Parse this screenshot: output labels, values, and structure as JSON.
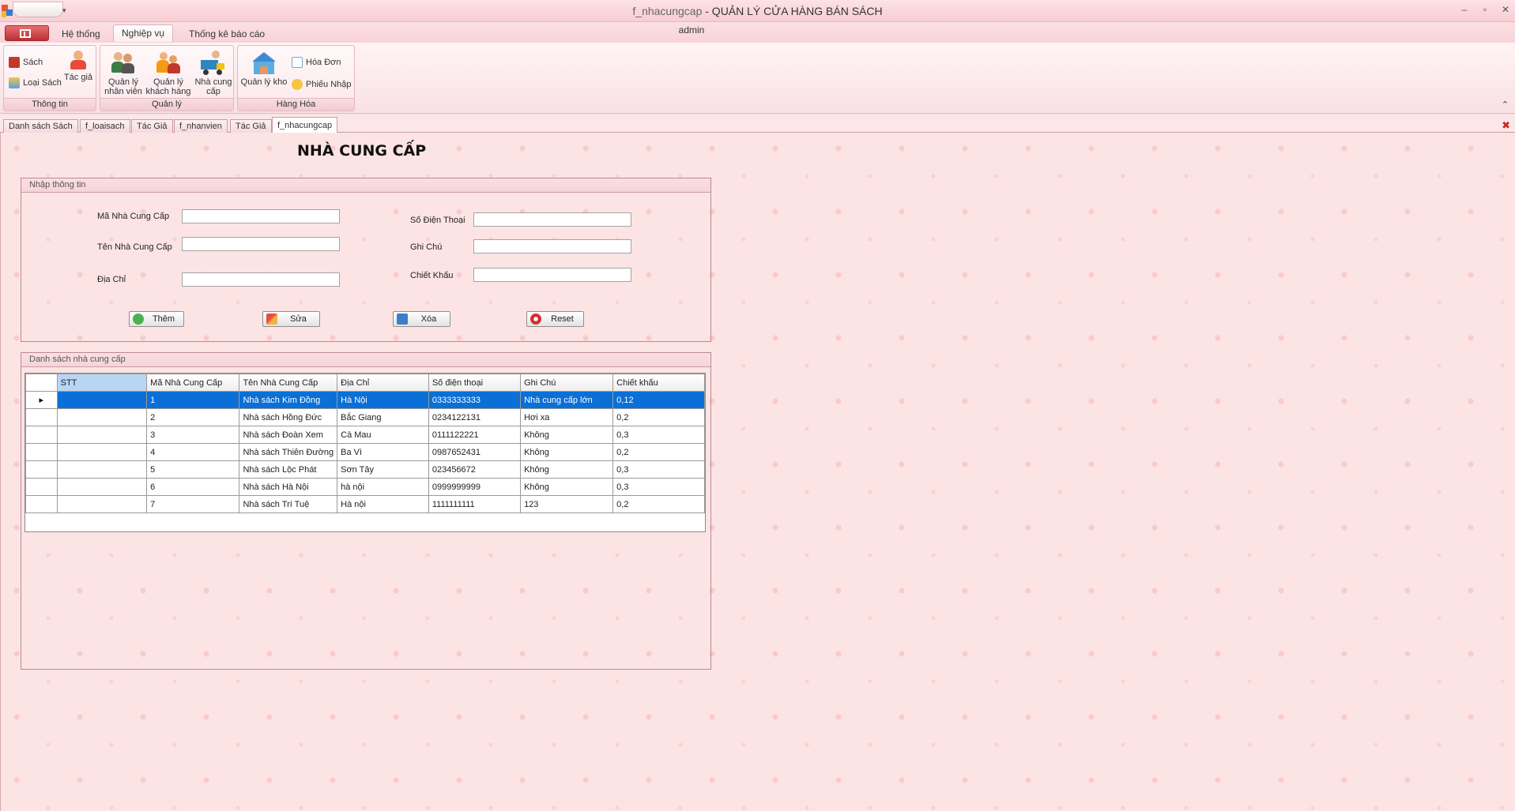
{
  "window": {
    "doc_title": "f_nhacungcap",
    "app_title": " - QUẢN LÝ CỬA HÀNG BÁN SÁCH",
    "controls": [
      "–",
      "▫",
      "✕"
    ]
  },
  "ribbon": {
    "user": "admin",
    "tabs": [
      "Hệ thống",
      "Nghiệp vụ",
      "Thống kê báo cáo"
    ],
    "active_tab": "Nghiệp vụ",
    "groups": {
      "thong_tin": {
        "label": "Thông tin",
        "sach": "Sách",
        "loai_sach": "Loại Sách",
        "tac_gia": "Tác giả"
      },
      "quan_ly": {
        "label": "Quản lý",
        "nhan_vien_1": "Quản lý",
        "nhan_vien_2": "nhân viên",
        "khach_hang_1": "Quản lý",
        "khach_hang_2": "khách hàng",
        "ncc_1": "Nhà cung",
        "ncc_2": "cấp"
      },
      "hang_hoa": {
        "label": "Hàng Hóa",
        "kho": "Quản lý kho",
        "hoa_don": "Hóa Đơn",
        "phieu_nhap": "Phiếu Nhập"
      }
    }
  },
  "doc_tabs": [
    "Danh sách Sách",
    "f_loaisach",
    "Tác Giả",
    "f_nhanvien",
    "Tác Giả",
    "f_nhacungcap"
  ],
  "form": {
    "title": "NHÀ CUNG CẤP",
    "input_group": "Nhập thông tin",
    "labels": {
      "ma": "Mã Nhà Cung Cấp",
      "ten": "Tên Nhà Cung Cấp",
      "dia_chi": "Địa Chỉ",
      "sdt": "Số Điện Thoại",
      "ghi_chu": "Ghi Chú",
      "chiet_khau": "Chiết Khấu"
    },
    "values": {
      "ma": "",
      "ten": "",
      "dia_chi": "",
      "sdt": "",
      "ghi_chu": "",
      "chiet_khau": ""
    },
    "buttons": {
      "them": "Thêm",
      "sua": "Sửa",
      "xoa": "Xóa",
      "reset": "Reset"
    }
  },
  "list": {
    "caption": "Danh sách nhà cung cấp",
    "columns": [
      "STT",
      "Mã Nhà Cung Cấp",
      "Tên Nhà Cung Cấp",
      "Địa Chỉ",
      "Số điện thoại",
      "Ghi Chú",
      "Chiết khấu"
    ],
    "selected_row": 0,
    "rows": [
      [
        "",
        "1",
        "Nhà sách Kim Đồng",
        "Hà Nội",
        "0333333333",
        "Nhà cung cấp lớn",
        "0,12"
      ],
      [
        "",
        "2",
        "Nhà sách Hồng Đức",
        "Bắc Giang",
        "0234122131",
        "Hơi xa",
        "0,2"
      ],
      [
        "",
        "3",
        "Nhà sách Đoàn Xem",
        "Cà Mau",
        "0111122221",
        "Không",
        "0,3"
      ],
      [
        "",
        "4",
        "Nhà sách Thiên Đường",
        "Ba Vì",
        "0987652431",
        "Không",
        "0,2"
      ],
      [
        "",
        "5",
        "Nhà sách Lộc Phát",
        "Sơn Tây",
        "023456672",
        "Không",
        "0,3"
      ],
      [
        "",
        "6",
        "Nhà sách Hà Nội",
        "hà nội",
        "0999999999",
        "Không",
        "0,3"
      ],
      [
        "",
        "7",
        "Nhà sách Trí Tuệ",
        "Hà nội",
        "1111111111",
        "123",
        "0,2"
      ]
    ]
  }
}
